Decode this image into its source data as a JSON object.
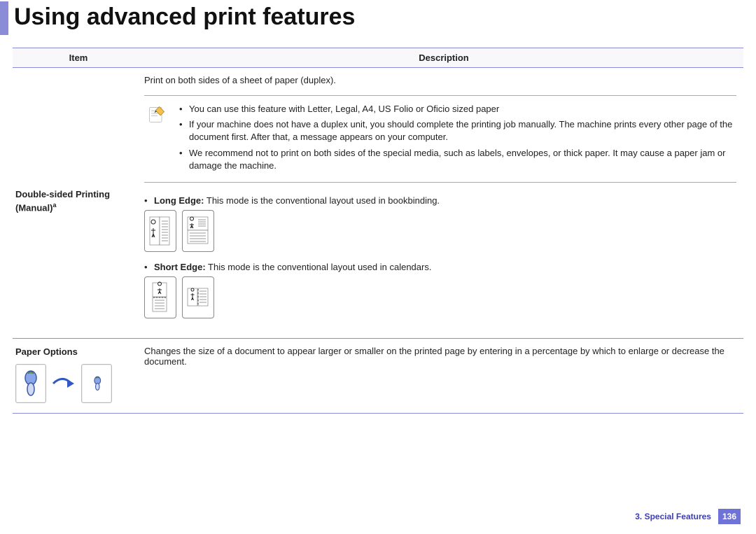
{
  "title": "Using advanced print features",
  "columns": {
    "item": "Item",
    "desc": "Description"
  },
  "rows": {
    "duplex": {
      "name": "Double-sided Printing",
      "qualifier": "(Manual)",
      "sup": "a",
      "intro": "Print on both sides of a sheet of paper (duplex).",
      "notes": [
        "You can use this feature with Letter, Legal, A4, US Folio or Oficio sized paper",
        "If your machine does not have a duplex unit, you should complete the printing job manually. The machine prints every other page of the document first. After that, a message appears on your computer.",
        "We recommend not to print on both sides of the special media, such as labels, envelopes, or thick paper. It may cause a paper jam or damage the machine."
      ],
      "modes": {
        "long": {
          "label": "Long Edge:",
          "text": " This mode is the conventional layout used in bookbinding."
        },
        "short": {
          "label": "Short Edge:",
          "text": " This mode is the conventional layout used in calendars."
        }
      }
    },
    "paper": {
      "name": "Paper Options",
      "desc": "Changes the size of a document to appear larger or smaller on the printed page by entering in a percentage by which to enlarge or decrease the document."
    }
  },
  "footer": {
    "chapter": "3.  Special Features",
    "page": "136"
  }
}
